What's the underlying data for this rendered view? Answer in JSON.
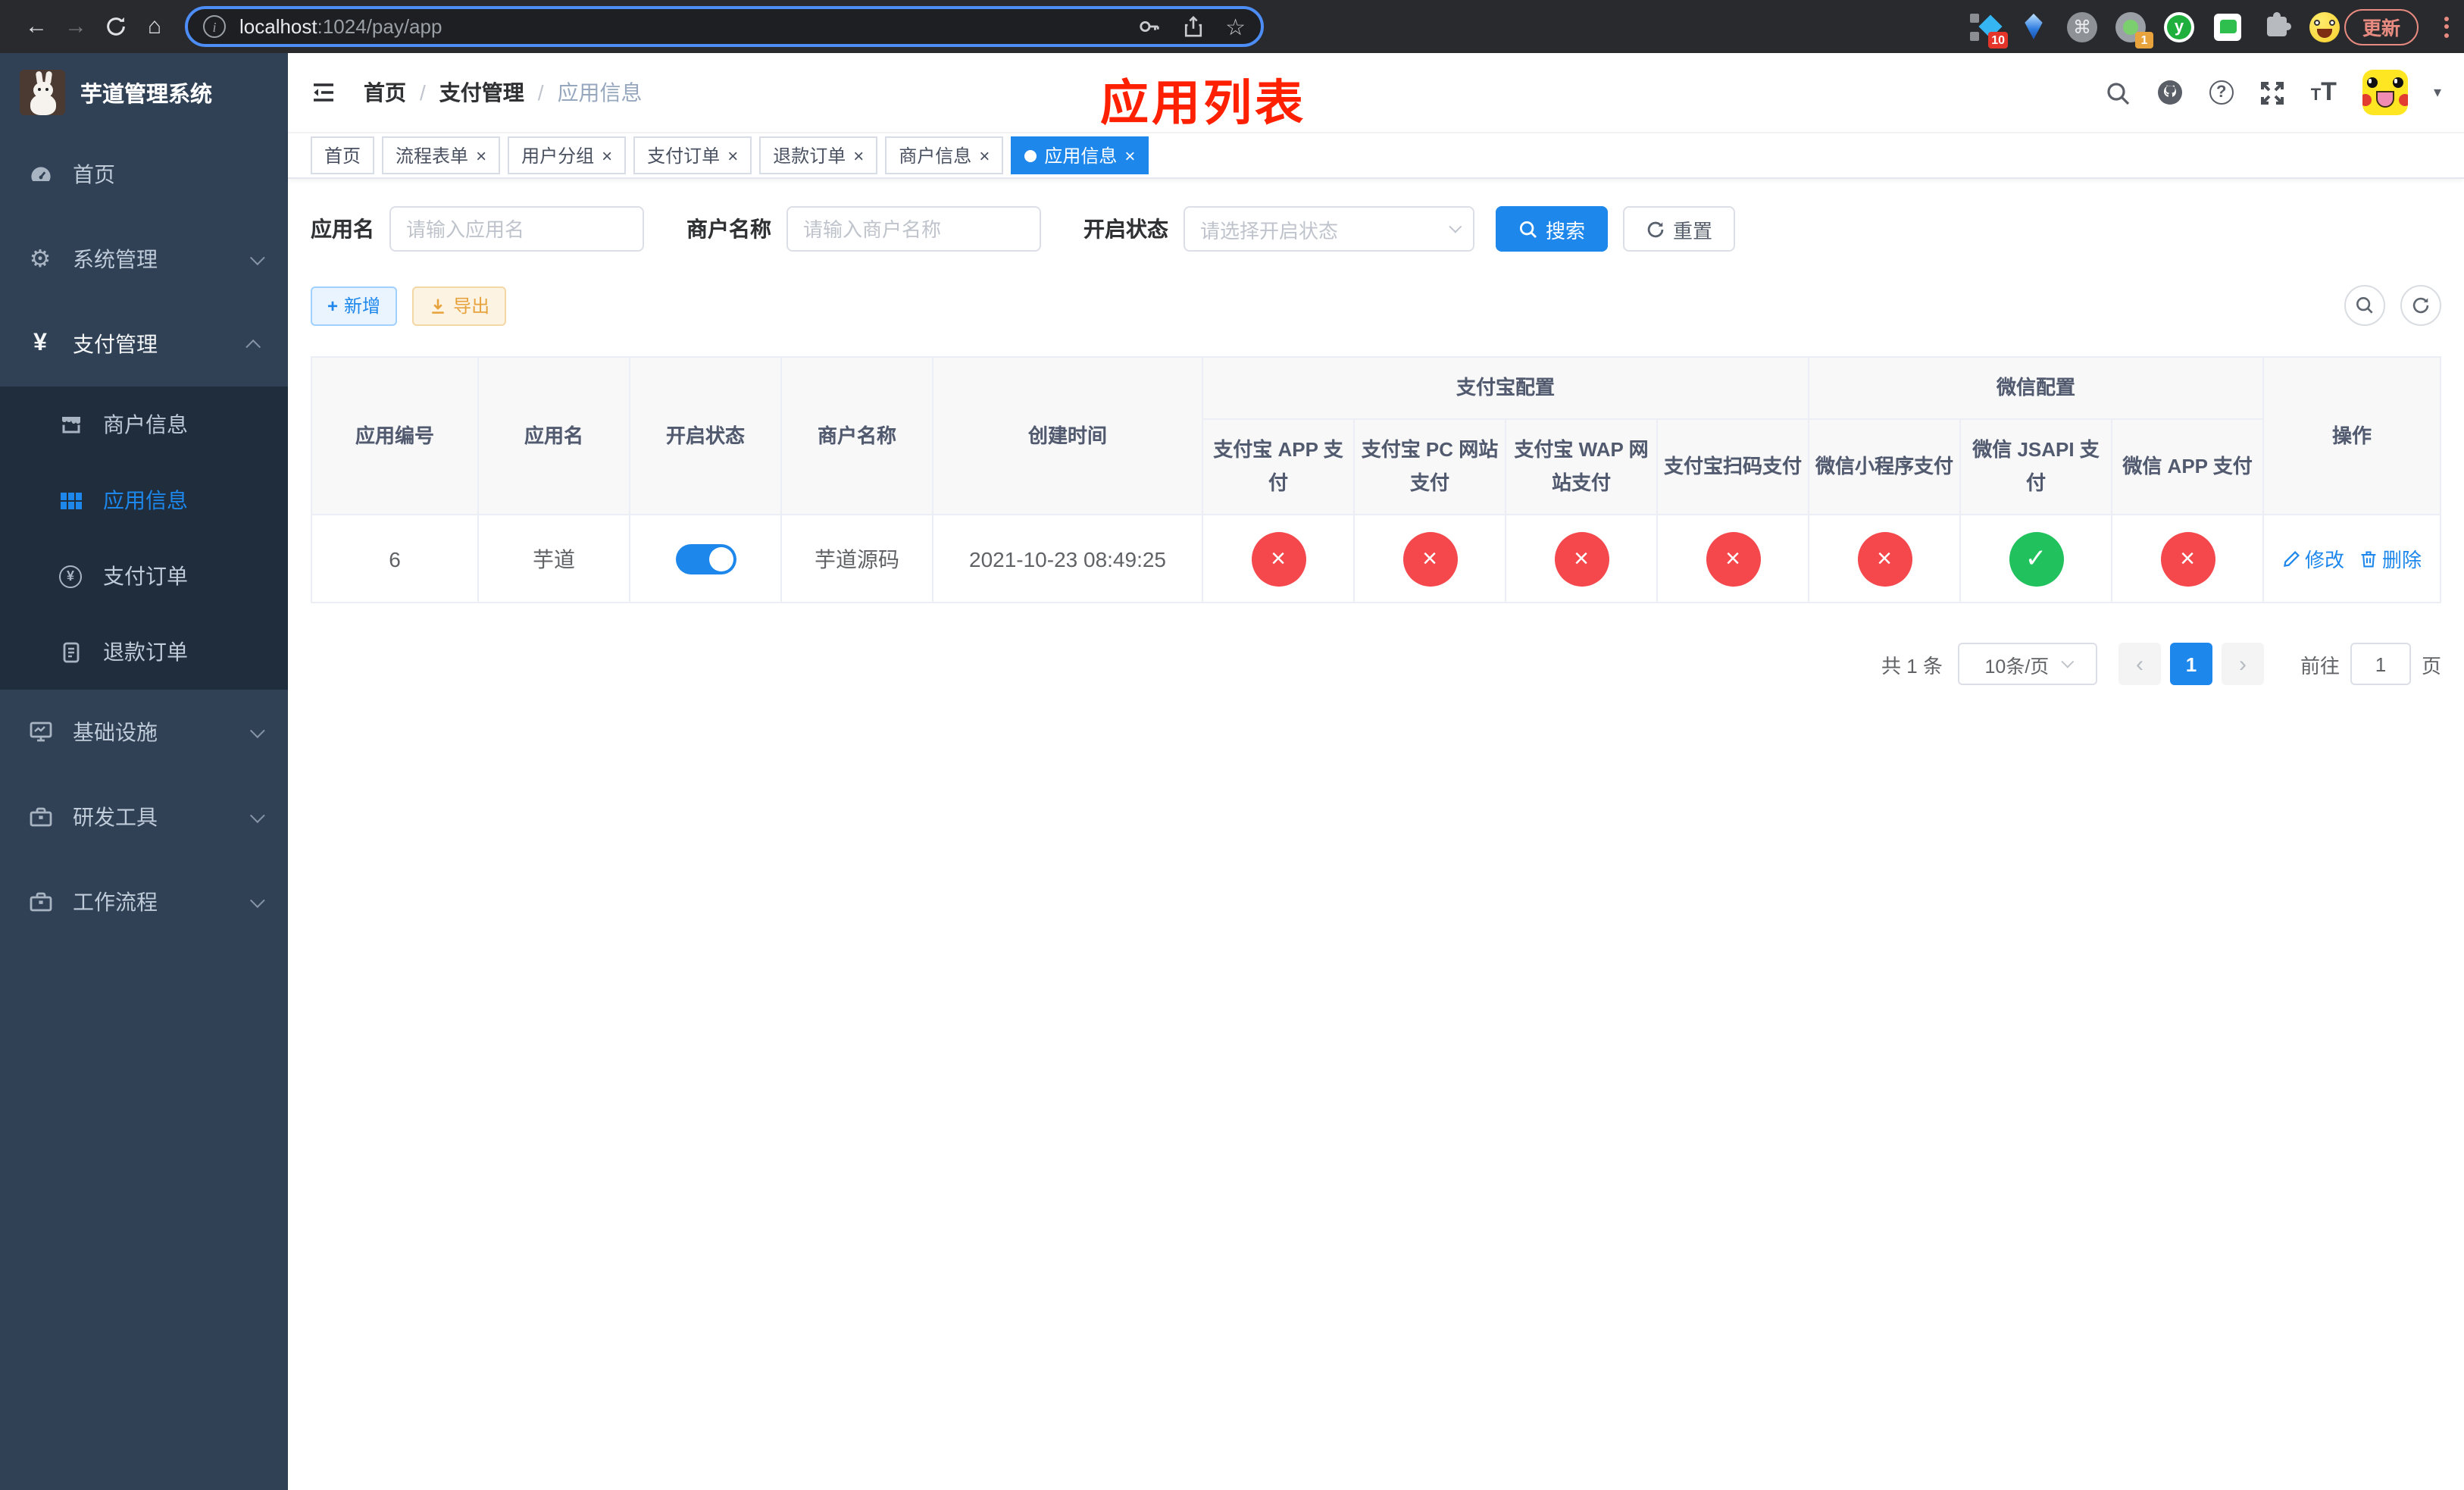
{
  "browser": {
    "url_host": "localhost",
    "url_path": ":1024/pay/app",
    "update_label": "更新",
    "ext_badge_blue_diamond": "10",
    "ext_badge_circle": "1",
    "ext_y_label": "y"
  },
  "icons": {
    "back": "←",
    "forward": "→",
    "home": "⌂",
    "info": "i",
    "star": "☆",
    "command": "⌘",
    "gear": "⚙",
    "yen": "¥",
    "question": "?",
    "caret_down": "▾",
    "plus": "+",
    "cross": "×",
    "check": "✓",
    "prev": "‹",
    "next": "›",
    "t_small": "T",
    "t_big": "T"
  },
  "sidebar": {
    "logo_title": "芋道管理系统",
    "items": [
      {
        "label": "首页"
      },
      {
        "label": "系统管理"
      },
      {
        "label": "支付管理"
      },
      {
        "label": "商户信息"
      },
      {
        "label": "应用信息"
      },
      {
        "label": "支付订单"
      },
      {
        "label": "退款订单"
      },
      {
        "label": "基础设施"
      },
      {
        "label": "研发工具"
      },
      {
        "label": "工作流程"
      }
    ]
  },
  "navbar": {
    "breadcrumb": [
      {
        "label": "首页"
      },
      {
        "label": "支付管理"
      },
      {
        "label": "应用信息"
      }
    ],
    "separator": "/",
    "annotation": "应用列表"
  },
  "tags": [
    {
      "label": "首页"
    },
    {
      "label": "流程表单"
    },
    {
      "label": "用户分组"
    },
    {
      "label": "支付订单"
    },
    {
      "label": "退款订单"
    },
    {
      "label": "商户信息"
    },
    {
      "label": "应用信息"
    }
  ],
  "filters": {
    "app_name_label": "应用名",
    "app_name_placeholder": "请输入应用名",
    "merchant_label": "商户名称",
    "merchant_placeholder": "请输入商户名称",
    "status_label": "开启状态",
    "status_placeholder": "请选择开启状态",
    "search_label": "搜索",
    "reset_label": "重置"
  },
  "toolbar": {
    "add_label": "新增",
    "export_label": "导出"
  },
  "table": {
    "columns": {
      "app_id": "应用编号",
      "app_name": "应用名",
      "status": "开启状态",
      "merchant": "商户名称",
      "created": "创建时间",
      "ops": "操作"
    },
    "groups": {
      "alipay": "支付宝配置",
      "wechat": "微信配置"
    },
    "sub_columns": [
      "支付宝 APP 支付",
      "支付宝 PC 网站支付",
      "支付宝 WAP 网站支付",
      "支付宝扫码支付",
      "微信小程序支付",
      "微信 JSAPI 支付",
      "微信 APP 支付"
    ],
    "row": {
      "app_id": "6",
      "app_name": "芋道",
      "merchant": "芋道源码",
      "created": "2021-10-23 08:49:25",
      "pay_statuses": [
        false,
        false,
        false,
        false,
        false,
        true,
        false
      ]
    },
    "edit_label": "修改",
    "delete_label": "删除"
  },
  "pagination": {
    "total": "共 1 条",
    "page_size": "10条/页",
    "current_page": "1",
    "goto_prefix": "前往",
    "goto_value": "1",
    "goto_suffix": "页"
  },
  "colors": {
    "accent_blue": "#1d87ec",
    "status_red": "#f5484d",
    "status_green": "#21c15e",
    "sidebar_bg": "#304156",
    "submenu_bg": "#1f2d3d",
    "annotation_red": "#ff2000",
    "export_orange": "#e6a23c"
  }
}
